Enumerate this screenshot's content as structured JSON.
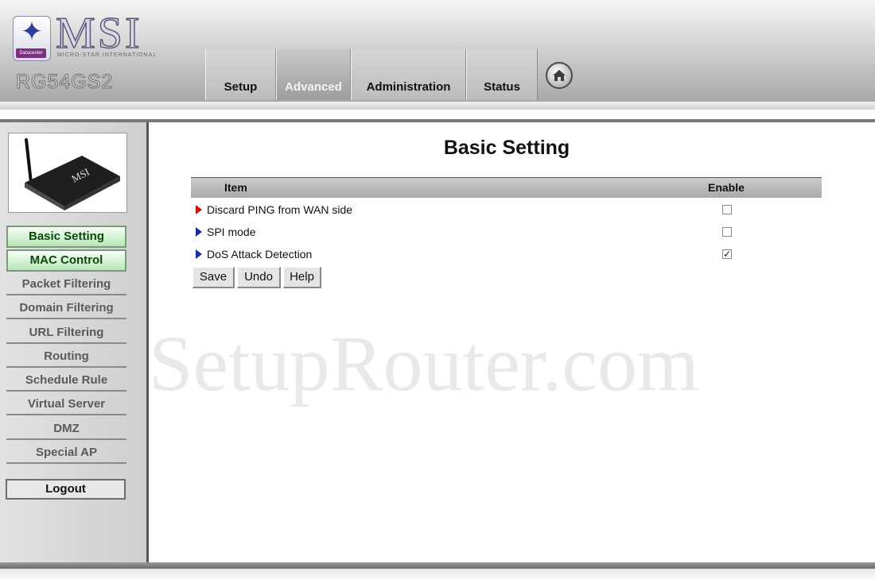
{
  "header": {
    "brand": "MSI",
    "brand_sub": "MICRO-STAR INTERNATIONAL",
    "logo_tag": "Datacenter",
    "model": "RG54GS2",
    "tabs": [
      {
        "label": "Setup",
        "active": false
      },
      {
        "label": "Advanced",
        "active": true
      },
      {
        "label": "Administration",
        "active": false
      },
      {
        "label": "Status",
        "active": false
      }
    ],
    "home_icon": "home-icon"
  },
  "sidebar": {
    "image_label": "router-image",
    "items": [
      {
        "label": "Basic Setting",
        "highlight": true
      },
      {
        "label": "MAC Control",
        "highlight": true
      },
      {
        "label": "Packet Filtering",
        "highlight": false
      },
      {
        "label": "Domain Filtering",
        "highlight": false
      },
      {
        "label": "URL Filtering",
        "highlight": false
      },
      {
        "label": "Routing",
        "highlight": false
      },
      {
        "label": "Schedule Rule",
        "highlight": false
      },
      {
        "label": "Virtual Server",
        "highlight": false
      },
      {
        "label": "DMZ",
        "highlight": false
      },
      {
        "label": "Special AP",
        "highlight": false
      }
    ],
    "logout": "Logout"
  },
  "main": {
    "title": "Basic Setting",
    "table": {
      "col_item": "Item",
      "col_enable": "Enable",
      "rows": [
        {
          "label": "Discard PING from WAN side",
          "bullet_color": "#c41515",
          "checked": false
        },
        {
          "label": "SPI mode",
          "bullet_color": "#1a2aa8",
          "checked": false
        },
        {
          "label": "DoS Attack Detection",
          "bullet_color": "#1a2aa8",
          "checked": true
        }
      ]
    },
    "buttons": {
      "save": "Save",
      "undo": "Undo",
      "help": "Help"
    }
  },
  "watermark": "SetupRouter.com"
}
